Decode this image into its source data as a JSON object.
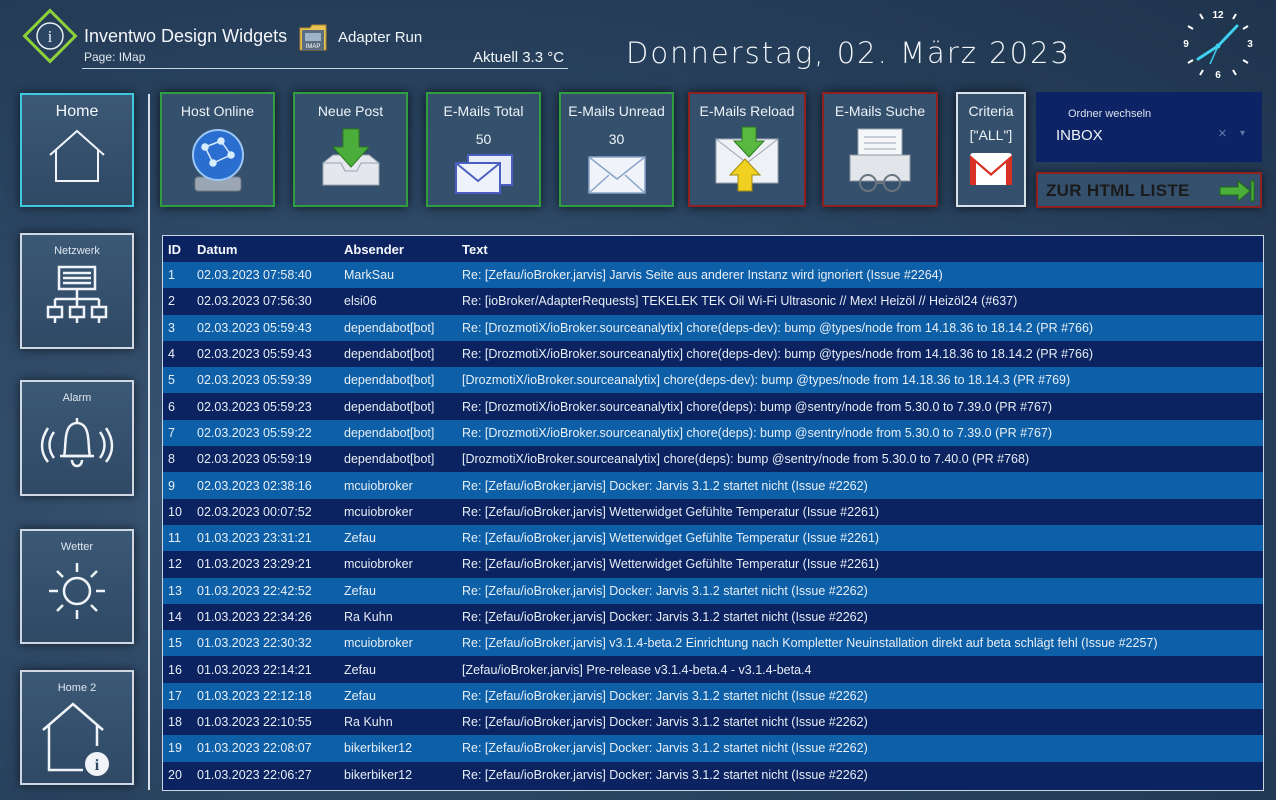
{
  "header": {
    "app_title": "Inventwo Design Widgets",
    "page_label": "Page: IMap",
    "adapter_label": "Adapter Run",
    "temperature": "Aktuell 3.3 °C",
    "date": "Donnerstag, 02. März 2023",
    "adapter_icon_text": "IMAP",
    "logo_letter": "i"
  },
  "clock": {
    "n12": "12",
    "n3": "3",
    "n6": "6",
    "n9": "9"
  },
  "sidebar": {
    "items": [
      {
        "label": "Home"
      },
      {
        "label": "Netzwerk"
      },
      {
        "label": "Alarm"
      },
      {
        "label": "Wetter"
      },
      {
        "label": "Home 2"
      }
    ]
  },
  "tiles": {
    "host_online": "Host Online",
    "neue_post": "Neue Post",
    "mails_total": "E-Mails Total",
    "mails_total_value": "50",
    "mails_unread": "E-Mails Unread",
    "mails_unread_value": "30",
    "mails_reload": "E-Mails Reload",
    "mails_suche": "E-Mails Suche",
    "criteria": "Criteria",
    "criteria_value": "[\"ALL\"]"
  },
  "folder": {
    "label": "Ordner wechseln",
    "value": "INBOX",
    "clear": "×",
    "arrow": "▾"
  },
  "html_list": {
    "label": "ZUR HTML LISTE"
  },
  "colors": {
    "accent_green": "#2e9e3e",
    "accent_red": "#8e2020",
    "home_border": "#3fc9e0",
    "table_row_light": "#0d60a8",
    "table_row_dark": "#0b2360"
  },
  "table": {
    "headers": [
      "ID",
      "Datum",
      "Absender",
      "Text"
    ],
    "rows": [
      [
        "1",
        "02.03.2023 07:58:40",
        "MarkSau",
        "Re: [Zefau/ioBroker.jarvis] Jarvis Seite aus anderer Instanz wird ignoriert (Issue #2264)"
      ],
      [
        "2",
        "02.03.2023 07:56:30",
        "elsi06",
        "Re: [ioBroker/AdapterRequests] TEKELEK TEK Oil Wi-Fi Ultrasonic // Mex! Heizöl // Heizöl24 (#637)"
      ],
      [
        "3",
        "02.03.2023 05:59:43",
        "dependabot[bot]",
        "Re: [DrozmotiX/ioBroker.sourceanalytix] chore(deps-dev): bump @types/node from 14.18.36 to 18.14.2 (PR #766)"
      ],
      [
        "4",
        "02.03.2023 05:59:43",
        "dependabot[bot]",
        "Re: [DrozmotiX/ioBroker.sourceanalytix] chore(deps-dev): bump @types/node from 14.18.36 to 18.14.2 (PR #766)"
      ],
      [
        "5",
        "02.03.2023 05:59:39",
        "dependabot[bot]",
        "[DrozmotiX/ioBroker.sourceanalytix] chore(deps-dev): bump @types/node from 14.18.36 to 18.14.3 (PR #769)"
      ],
      [
        "6",
        "02.03.2023 05:59:23",
        "dependabot[bot]",
        "Re: [DrozmotiX/ioBroker.sourceanalytix] chore(deps): bump @sentry/node from 5.30.0 to 7.39.0 (PR #767)"
      ],
      [
        "7",
        "02.03.2023 05:59:22",
        "dependabot[bot]",
        "Re: [DrozmotiX/ioBroker.sourceanalytix] chore(deps): bump @sentry/node from 5.30.0 to 7.39.0 (PR #767)"
      ],
      [
        "8",
        "02.03.2023 05:59:19",
        "dependabot[bot]",
        "[DrozmotiX/ioBroker.sourceanalytix] chore(deps): bump @sentry/node from 5.30.0 to 7.40.0 (PR #768)"
      ],
      [
        "9",
        "02.03.2023 02:38:16",
        "mcuiobroker",
        "Re: [Zefau/ioBroker.jarvis] Docker: Jarvis 3.1.2 startet nicht (Issue #2262)"
      ],
      [
        "10",
        "02.03.2023 00:07:52",
        "mcuiobroker",
        "Re: [Zefau/ioBroker.jarvis] Wetterwidget Gefühlte Temperatur (Issue #2261)"
      ],
      [
        "11",
        "01.03.2023 23:31:21",
        "Zefau",
        "Re: [Zefau/ioBroker.jarvis] Wetterwidget Gefühlte Temperatur (Issue #2261)"
      ],
      [
        "12",
        "01.03.2023 23:29:21",
        "mcuiobroker",
        "Re: [Zefau/ioBroker.jarvis] Wetterwidget Gefühlte Temperatur (Issue #2261)"
      ],
      [
        "13",
        "01.03.2023 22:42:52",
        "Zefau",
        "Re: [Zefau/ioBroker.jarvis] Docker: Jarvis 3.1.2 startet nicht (Issue #2262)"
      ],
      [
        "14",
        "01.03.2023 22:34:26",
        "Ra Kuhn",
        "Re: [Zefau/ioBroker.jarvis] Docker: Jarvis 3.1.2 startet nicht (Issue #2262)"
      ],
      [
        "15",
        "01.03.2023 22:30:32",
        "mcuiobroker",
        "Re: [Zefau/ioBroker.jarvis] v3.1.4-beta.2 Einrichtung nach Kompletter Neuinstallation direkt auf beta schlägt fehl (Issue #2257)"
      ],
      [
        "16",
        "01.03.2023 22:14:21",
        "Zefau",
        "[Zefau/ioBroker.jarvis] Pre-release v3.1.4-beta.4 - v3.1.4-beta.4"
      ],
      [
        "17",
        "01.03.2023 22:12:18",
        "Zefau",
        "Re: [Zefau/ioBroker.jarvis] Docker: Jarvis 3.1.2 startet nicht (Issue #2262)"
      ],
      [
        "18",
        "01.03.2023 22:10:55",
        "Ra Kuhn",
        "Re: [Zefau/ioBroker.jarvis] Docker: Jarvis 3.1.2 startet nicht (Issue #2262)"
      ],
      [
        "19",
        "01.03.2023 22:08:07",
        "bikerbiker12",
        "Re: [Zefau/ioBroker.jarvis] Docker: Jarvis 3.1.2 startet nicht (Issue #2262)"
      ],
      [
        "20",
        "01.03.2023 22:06:27",
        "bikerbiker12",
        "Re: [Zefau/ioBroker.jarvis] Docker: Jarvis 3.1.2 startet nicht (Issue #2262)"
      ]
    ]
  }
}
